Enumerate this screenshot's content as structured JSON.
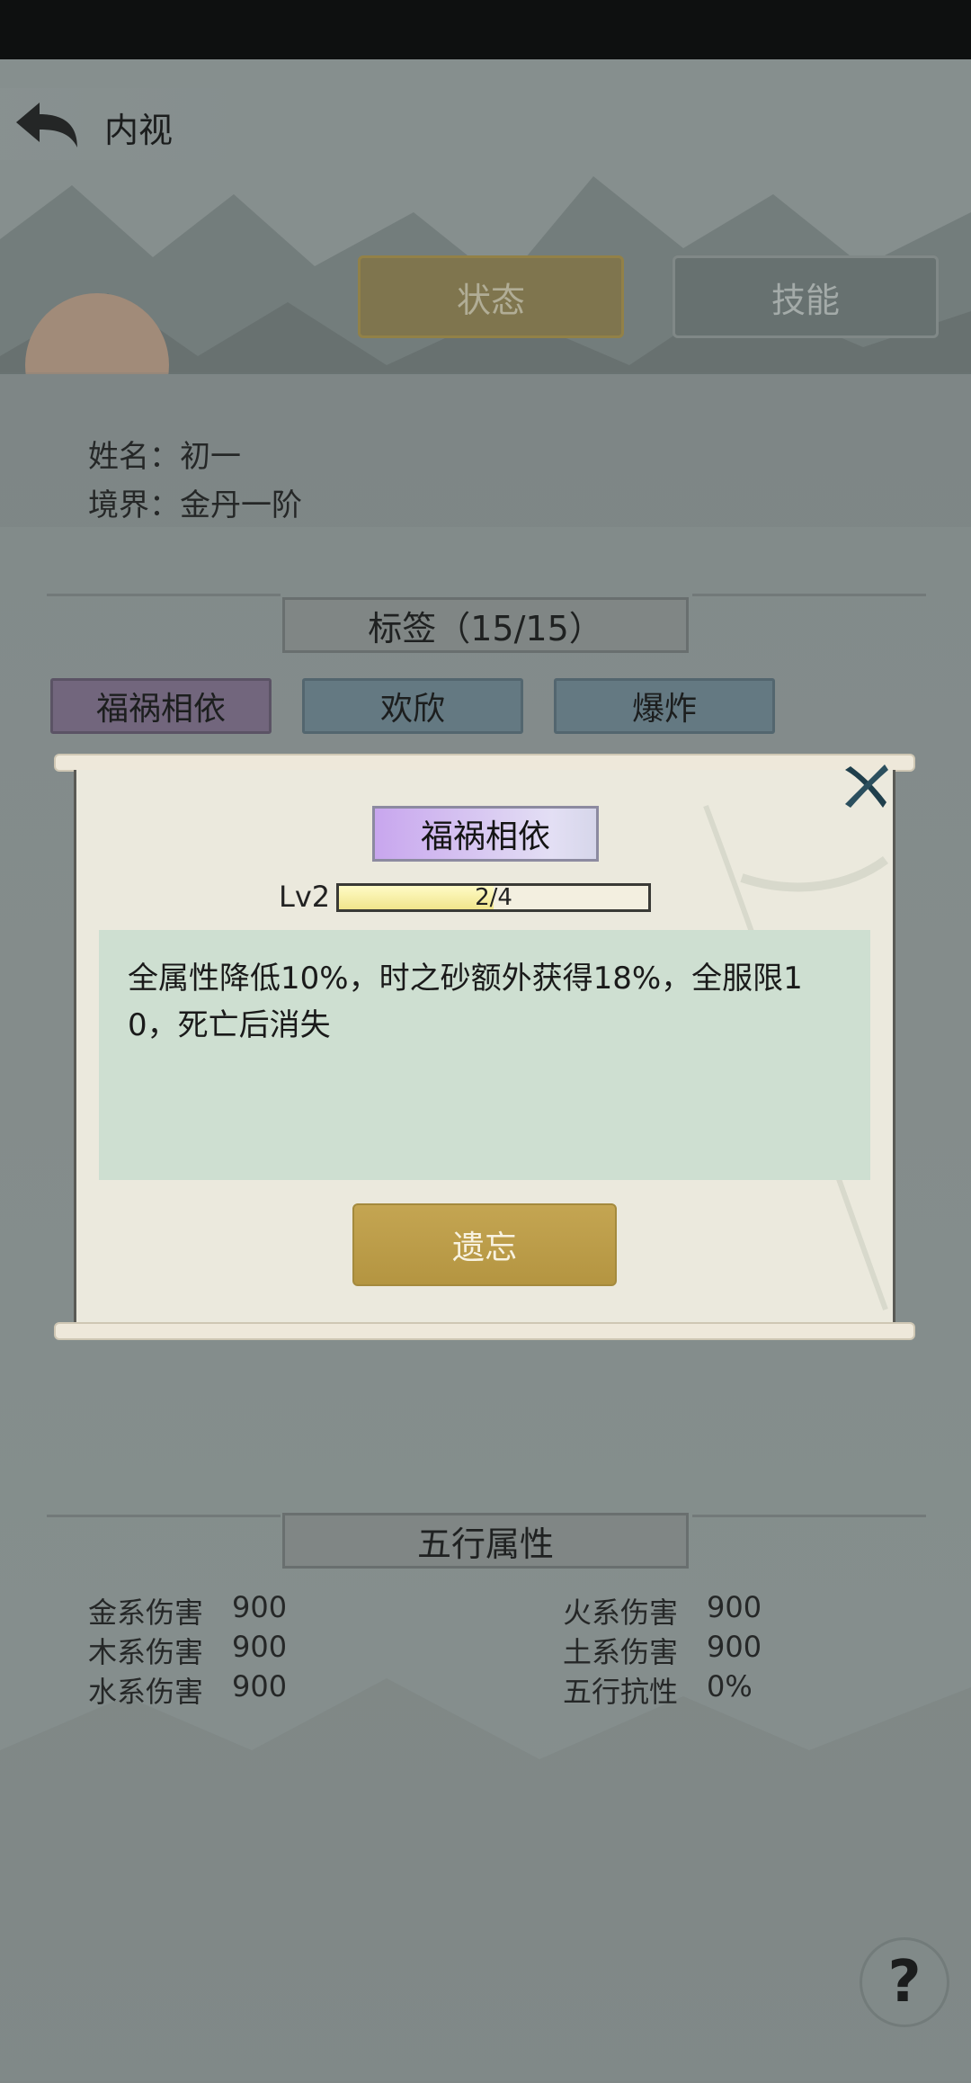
{
  "header": {
    "title": "内视"
  },
  "tabs": [
    {
      "label": "状态",
      "active": true
    },
    {
      "label": "技能",
      "active": false
    }
  ],
  "character": {
    "name_line": "姓名：初一",
    "realm_line": "境界：金丹一阶"
  },
  "tags_section": {
    "title": "标签（15/15）",
    "chips": [
      "福祸相依",
      "欢欣",
      "爆炸"
    ]
  },
  "dialog": {
    "tag_name": "福祸相依",
    "level_label": "Lv2",
    "progress_text": "2/4",
    "progress_fraction": 0.5,
    "description": "全属性降低10%，时之砂额外获得18%，全服限10，死亡后消失",
    "forget_label": "遗忘"
  },
  "five_elements": {
    "title": "五行属性",
    "left": [
      {
        "name": "金系伤害",
        "value": "900"
      },
      {
        "name": "木系伤害",
        "value": "900"
      },
      {
        "name": "水系伤害",
        "value": "900"
      }
    ],
    "right": [
      {
        "name": "火系伤害",
        "value": "900"
      },
      {
        "name": "土系伤害",
        "value": "900"
      },
      {
        "name": "五行抗性",
        "value": "0%"
      }
    ]
  },
  "help": {
    "label": "?"
  },
  "colors": {
    "accent_gold": "#c4a552",
    "tag_purple": "#c8a6ee",
    "desc_bg": "#cedfd1"
  }
}
